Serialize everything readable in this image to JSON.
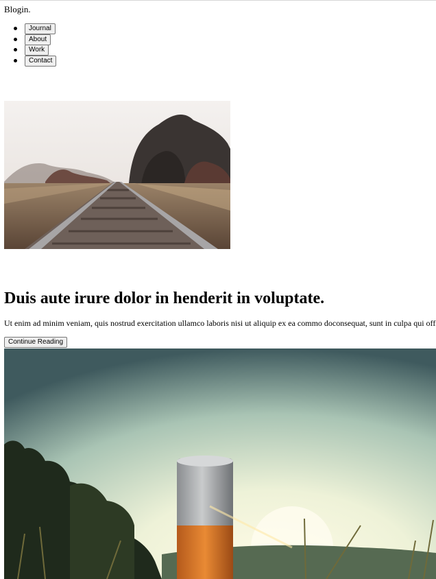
{
  "site": {
    "brand": "Blogin."
  },
  "nav": {
    "items": [
      {
        "label": "Journal"
      },
      {
        "label": "About"
      },
      {
        "label": "Work"
      },
      {
        "label": "Contact"
      }
    ]
  },
  "post": {
    "title": "Duis aute irure dolor in henderit in voluptate.",
    "excerpt": "Ut enim ad minim veniam, quis nostrud exercitation ullamco laboris nisi ut aliquip ex ea commo doconsequat, sunt in culpa qui officia deserunt mollit anim id est laborum.",
    "cta_label": "Continue Reading"
  },
  "images": {
    "first": "railroad-tracks-photo",
    "second": "sunset-field-post-photo"
  }
}
